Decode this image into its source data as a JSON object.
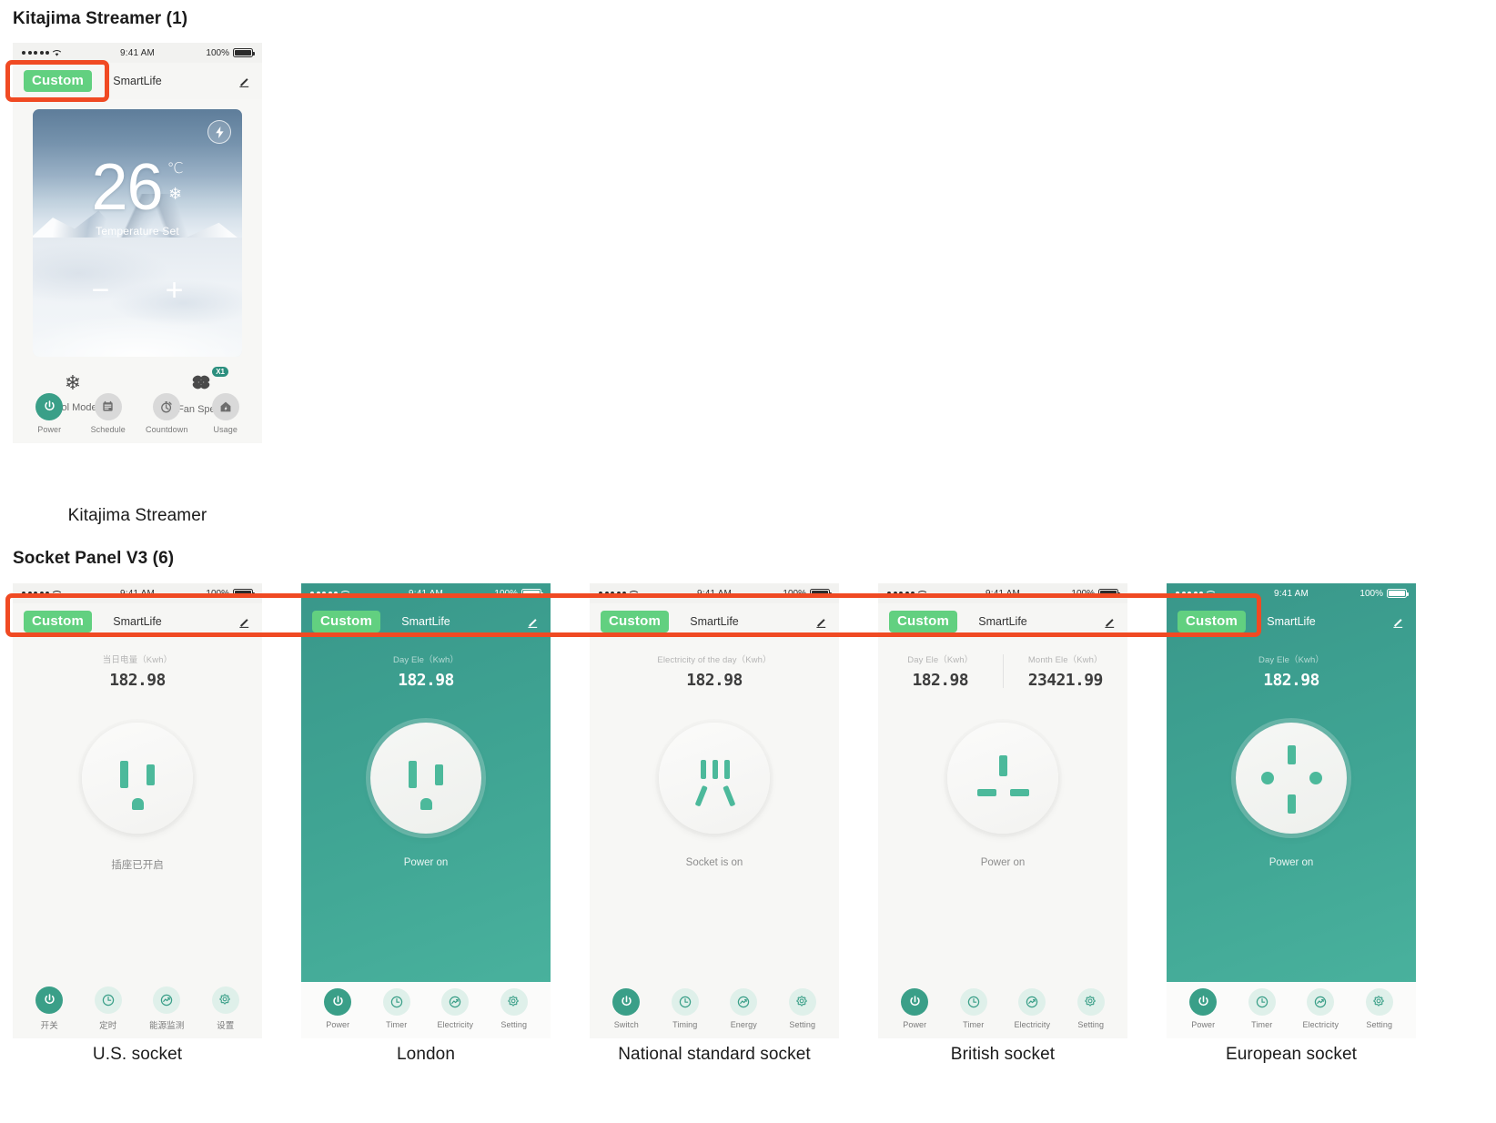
{
  "sections": [
    {
      "title": "Kitajima Streamer (1)"
    },
    {
      "title": "Socket Panel V3 (6)"
    }
  ],
  "status_bar": {
    "time": "9:41 AM",
    "battery": "100%"
  },
  "nav": {
    "badge": "Custom",
    "title": "SmartLife",
    "edit_icon": "pencil-icon"
  },
  "thermostat": {
    "caption": "Kitajima Streamer",
    "temperature": "26",
    "unit": "℃",
    "mode_glyph": "❄",
    "set_label": "Temperature Set",
    "decrease": "−",
    "increase": "+",
    "bolt_icon": "bolt-icon",
    "modes": [
      {
        "label": "Cool Mode",
        "glyph": "❄",
        "badge": ""
      },
      {
        "label": "Fan Speed",
        "glyph": "fan-icon",
        "badge": "X1"
      }
    ],
    "toolbar": [
      {
        "label": "Power",
        "icon": "power-icon",
        "active": true
      },
      {
        "label": "Schedule",
        "icon": "calendar-icon",
        "active": false
      },
      {
        "label": "Countdown",
        "icon": "stopwatch-icon",
        "active": false
      },
      {
        "label": "Usage",
        "icon": "home-energy-icon",
        "active": false
      }
    ]
  },
  "sockets": [
    {
      "caption": "U.S. socket",
      "theme": "light",
      "meters": [
        {
          "label": "当日电量（Kwh）",
          "value": "182.98"
        }
      ],
      "status": "插座已开启",
      "toolbar": [
        {
          "label": "开关",
          "icon": "power-icon",
          "active": true
        },
        {
          "label": "定时",
          "icon": "clock-icon",
          "active": false
        },
        {
          "label": "能源监测",
          "icon": "energy-icon",
          "active": false
        },
        {
          "label": "设置",
          "icon": "gear-icon",
          "active": false
        }
      ]
    },
    {
      "caption": "London",
      "theme": "green",
      "meters": [
        {
          "label": "Day Ele（Kwh）",
          "value": "182.98"
        }
      ],
      "status": "Power on",
      "toolbar": [
        {
          "label": "Power",
          "icon": "power-icon",
          "active": true
        },
        {
          "label": "Timer",
          "icon": "clock-icon",
          "active": false
        },
        {
          "label": "Electricity",
          "icon": "energy-icon",
          "active": false
        },
        {
          "label": "Setting",
          "icon": "gear-icon",
          "active": false
        }
      ]
    },
    {
      "caption": "National standard socket",
      "theme": "light",
      "meters": [
        {
          "label": "Electricity of the day（Kwh）",
          "value": "182.98"
        }
      ],
      "status": "Socket is on",
      "toolbar": [
        {
          "label": "Switch",
          "icon": "power-icon",
          "active": true
        },
        {
          "label": "Timing",
          "icon": "clock-icon",
          "active": false
        },
        {
          "label": "Energy",
          "icon": "energy-icon",
          "active": false
        },
        {
          "label": "Setting",
          "icon": "gear-icon",
          "active": false
        }
      ]
    },
    {
      "caption": "British socket",
      "theme": "light",
      "meters": [
        {
          "label": "Day Ele（Kwh）",
          "value": "182.98"
        },
        {
          "label": "Month Ele（Kwh）",
          "value": "23421.99"
        }
      ],
      "status": "Power on",
      "toolbar": [
        {
          "label": "Power",
          "icon": "power-icon",
          "active": true
        },
        {
          "label": "Timer",
          "icon": "clock-icon",
          "active": false
        },
        {
          "label": "Electricity",
          "icon": "energy-icon",
          "active": false
        },
        {
          "label": "Setting",
          "icon": "gear-icon",
          "active": false
        }
      ]
    },
    {
      "caption": "European socket",
      "theme": "green",
      "meters": [
        {
          "label": "Day Ele（Kwh）",
          "value": "182.98"
        }
      ],
      "status": "Power on",
      "toolbar": [
        {
          "label": "Power",
          "icon": "power-icon",
          "active": true
        },
        {
          "label": "Timer",
          "icon": "clock-icon",
          "active": false
        },
        {
          "label": "Electricity",
          "icon": "energy-icon",
          "active": false
        },
        {
          "label": "Setting",
          "icon": "gear-icon",
          "active": false
        }
      ]
    }
  ],
  "colors": {
    "badge_green": "#62d080",
    "accent_teal": "#3a9f88",
    "pin_green": "#4cb99b",
    "annotation_red": "#f04a23"
  }
}
